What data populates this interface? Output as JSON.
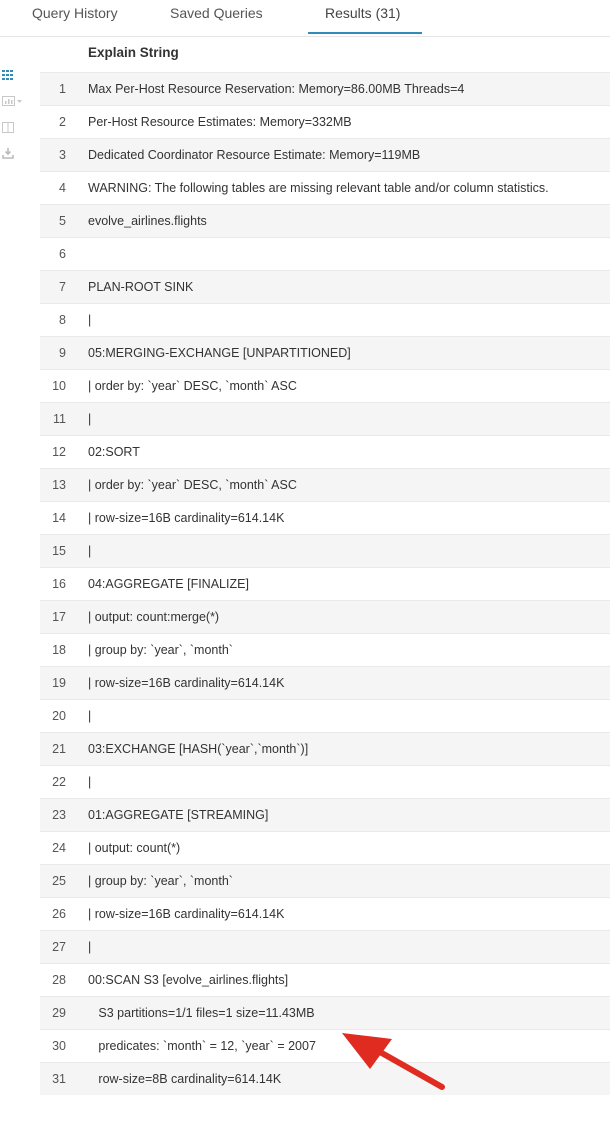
{
  "tabs": [
    {
      "label": "Query History"
    },
    {
      "label": "Saved Queries"
    },
    {
      "label": "Results (31)"
    }
  ],
  "toolbar": {
    "icons": [
      "grid-icon",
      "chart-icon",
      "columns-icon",
      "download-icon"
    ]
  },
  "table": {
    "column_header": "Explain String",
    "rows": [
      {
        "num": "1",
        "text": "Max Per-Host Resource Reservation: Memory=86.00MB Threads=4"
      },
      {
        "num": "2",
        "text": "Per-Host Resource Estimates: Memory=332MB"
      },
      {
        "num": "3",
        "text": "Dedicated Coordinator Resource Estimate: Memory=119MB"
      },
      {
        "num": "4",
        "text": "WARNING: The following tables are missing relevant table and/or column statistics."
      },
      {
        "num": "5",
        "text": "evolve_airlines.flights"
      },
      {
        "num": "6",
        "text": ""
      },
      {
        "num": "7",
        "text": "PLAN-ROOT SINK"
      },
      {
        "num": "8",
        "text": "|"
      },
      {
        "num": "9",
        "text": "05:MERGING-EXCHANGE [UNPARTITIONED]"
      },
      {
        "num": "10",
        "text": "| order by: `year` DESC, `month` ASC"
      },
      {
        "num": "11",
        "text": "|"
      },
      {
        "num": "12",
        "text": "02:SORT"
      },
      {
        "num": "13",
        "text": "| order by: `year` DESC, `month` ASC"
      },
      {
        "num": "14",
        "text": "| row-size=16B cardinality=614.14K"
      },
      {
        "num": "15",
        "text": "|"
      },
      {
        "num": "16",
        "text": "04:AGGREGATE [FINALIZE]"
      },
      {
        "num": "17",
        "text": "| output: count:merge(*)"
      },
      {
        "num": "18",
        "text": "| group by: `year`, `month`"
      },
      {
        "num": "19",
        "text": "| row-size=16B cardinality=614.14K"
      },
      {
        "num": "20",
        "text": "|"
      },
      {
        "num": "21",
        "text": "03:EXCHANGE [HASH(`year`,`month`)]"
      },
      {
        "num": "22",
        "text": "|"
      },
      {
        "num": "23",
        "text": "01:AGGREGATE [STREAMING]"
      },
      {
        "num": "24",
        "text": "| output: count(*)"
      },
      {
        "num": "25",
        "text": "| group by: `year`, `month`"
      },
      {
        "num": "26",
        "text": "| row-size=16B cardinality=614.14K"
      },
      {
        "num": "27",
        "text": "|"
      },
      {
        "num": "28",
        "text": "00:SCAN S3 [evolve_airlines.flights]"
      },
      {
        "num": "29",
        "text": "   S3 partitions=1/1 files=1 size=11.43MB"
      },
      {
        "num": "30",
        "text": "   predicates: `month` = 12, `year` = 2007"
      },
      {
        "num": "31",
        "text": "   row-size=8B cardinality=614.14K"
      }
    ]
  },
  "colors": {
    "accent": "#338bb8",
    "annotation_arrow": "#e02b20"
  }
}
